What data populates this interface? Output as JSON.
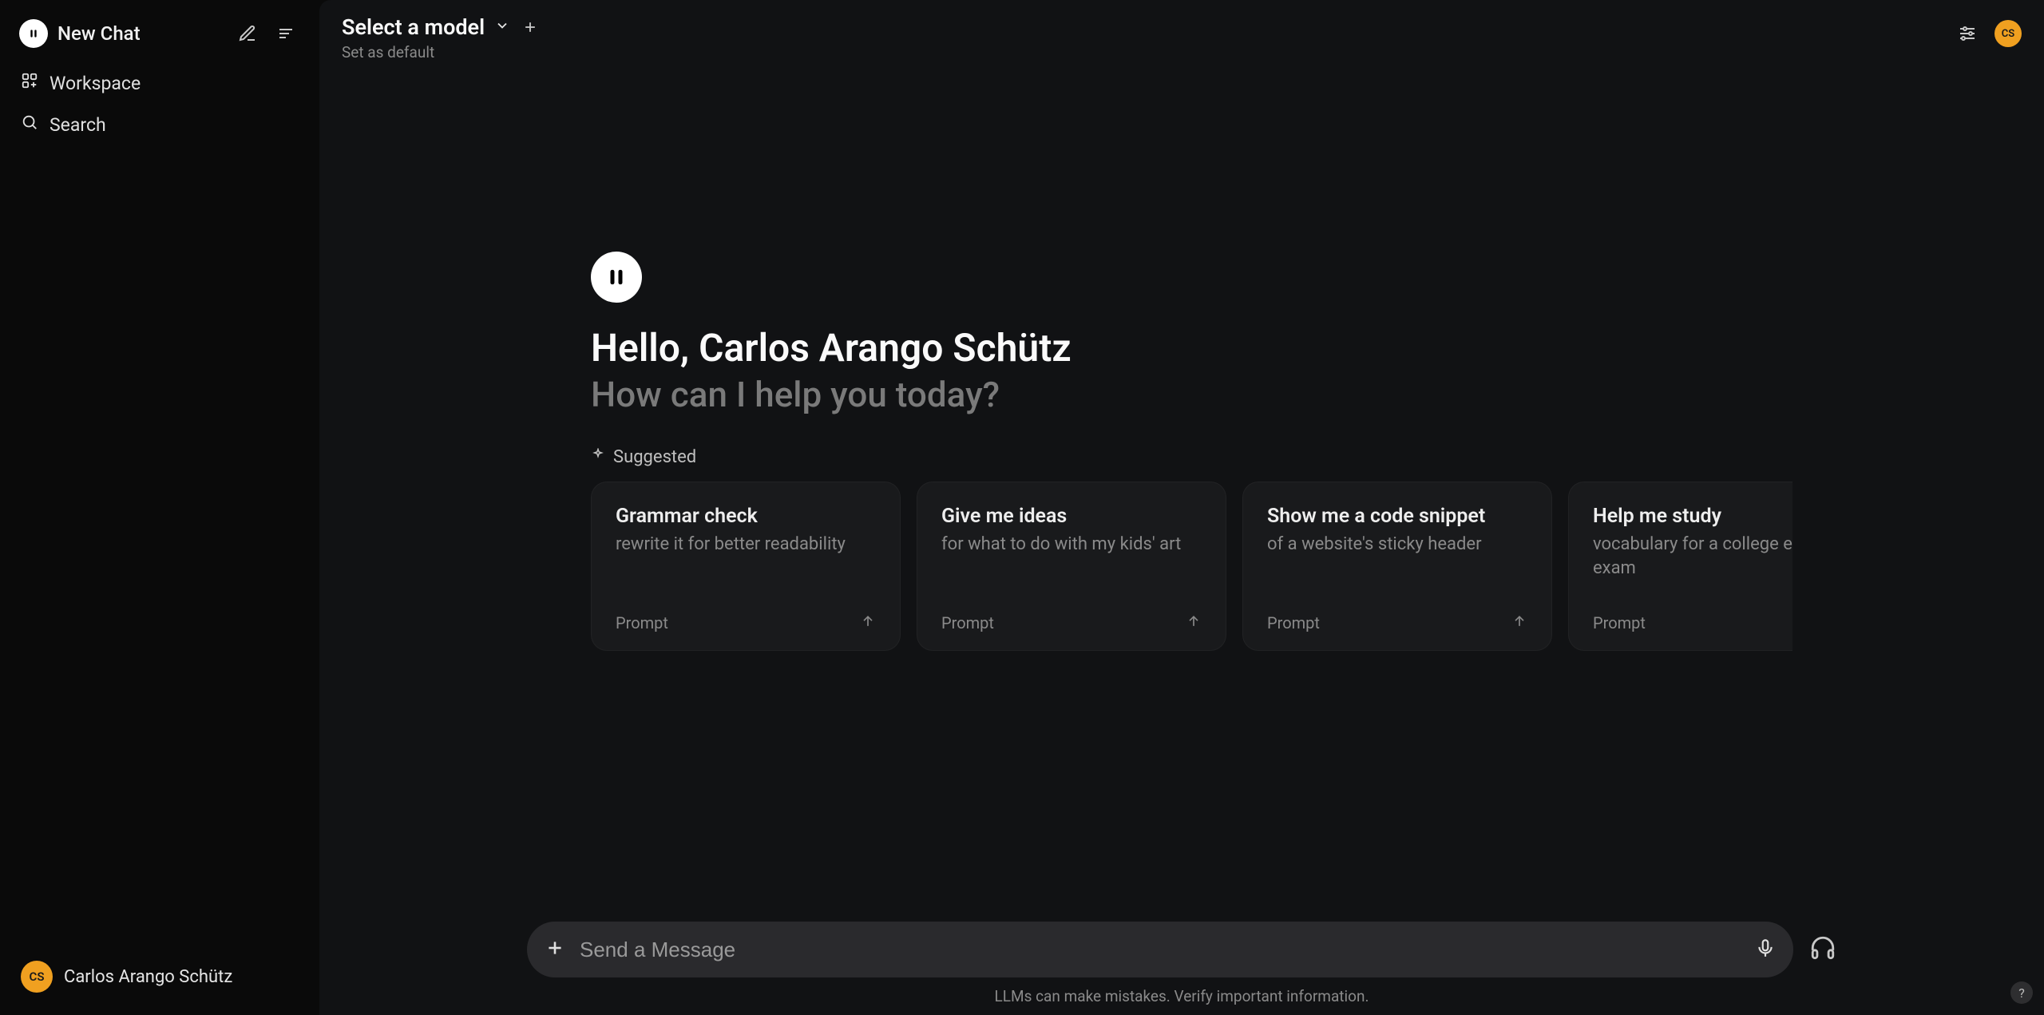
{
  "sidebar": {
    "new_chat_label": "New Chat",
    "workspace_label": "Workspace",
    "search_label": "Search"
  },
  "user": {
    "name": "Carlos Arango Schütz",
    "initials": "CS"
  },
  "header": {
    "model_selector_label": "Select a model",
    "set_default_label": "Set as default"
  },
  "greeting": {
    "hello_prefix": "Hello, ",
    "subtitle": "How can I help you today?",
    "suggested_label": "Suggested"
  },
  "cards": [
    {
      "title": "Grammar check",
      "subtitle": "rewrite it for better readability",
      "tag": "Prompt"
    },
    {
      "title": "Give me ideas",
      "subtitle": "for what to do with my kids' art",
      "tag": "Prompt"
    },
    {
      "title": "Show me a code snippet",
      "subtitle": "of a website's sticky header",
      "tag": "Prompt"
    },
    {
      "title": "Help me study",
      "subtitle": "vocabulary for a college entrance exam",
      "tag": "Prompt"
    }
  ],
  "composer": {
    "placeholder": "Send a Message"
  },
  "footer": {
    "disclaimer": "LLMs can make mistakes. Verify important information."
  },
  "help_label": "?"
}
